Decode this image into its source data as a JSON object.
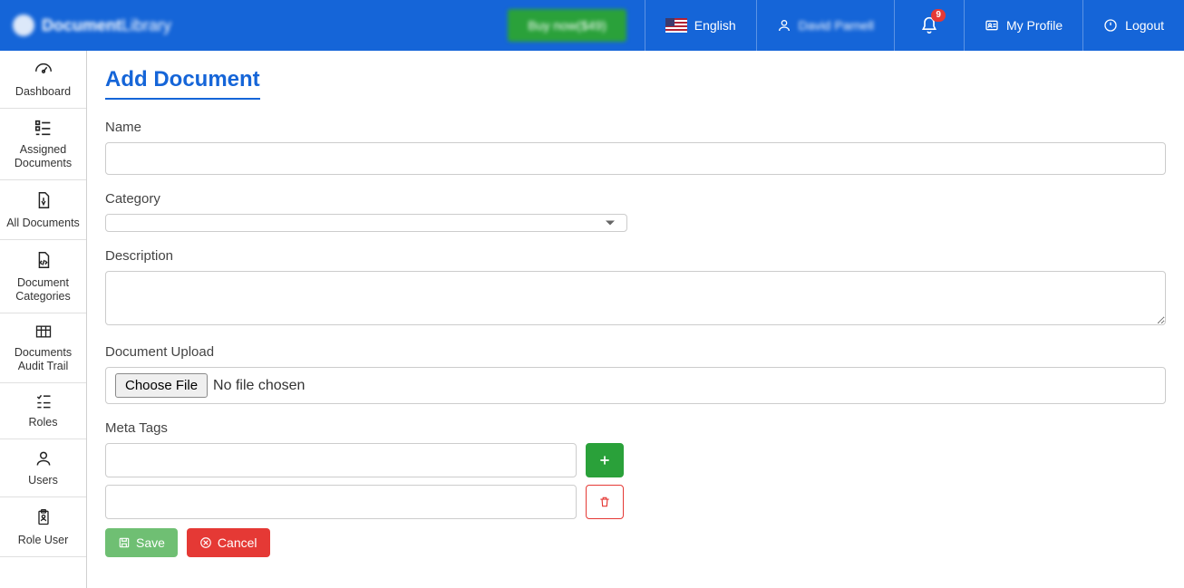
{
  "brand": {
    "name_part1": "Document",
    "name_part2": "Library"
  },
  "header": {
    "buy_label": "Buy now($49)",
    "language": "English",
    "user_name": "David Parnell",
    "notification_count": "9",
    "profile_label": "My Profile",
    "logout_label": "Logout"
  },
  "sidebar": {
    "items": [
      {
        "label": "Dashboard"
      },
      {
        "label": "Assigned Documents"
      },
      {
        "label": "All Documents"
      },
      {
        "label": "Document Categories"
      },
      {
        "label": "Documents Audit Trail"
      },
      {
        "label": "Roles"
      },
      {
        "label": "Users"
      },
      {
        "label": "Role User"
      }
    ]
  },
  "page": {
    "title": "Add Document",
    "name_label": "Name",
    "category_label": "Category",
    "description_label": "Description",
    "upload_label": "Document Upload",
    "choose_file": "Choose File",
    "no_file": "No file chosen",
    "meta_label": "Meta Tags",
    "save": "Save",
    "cancel": "Cancel"
  }
}
